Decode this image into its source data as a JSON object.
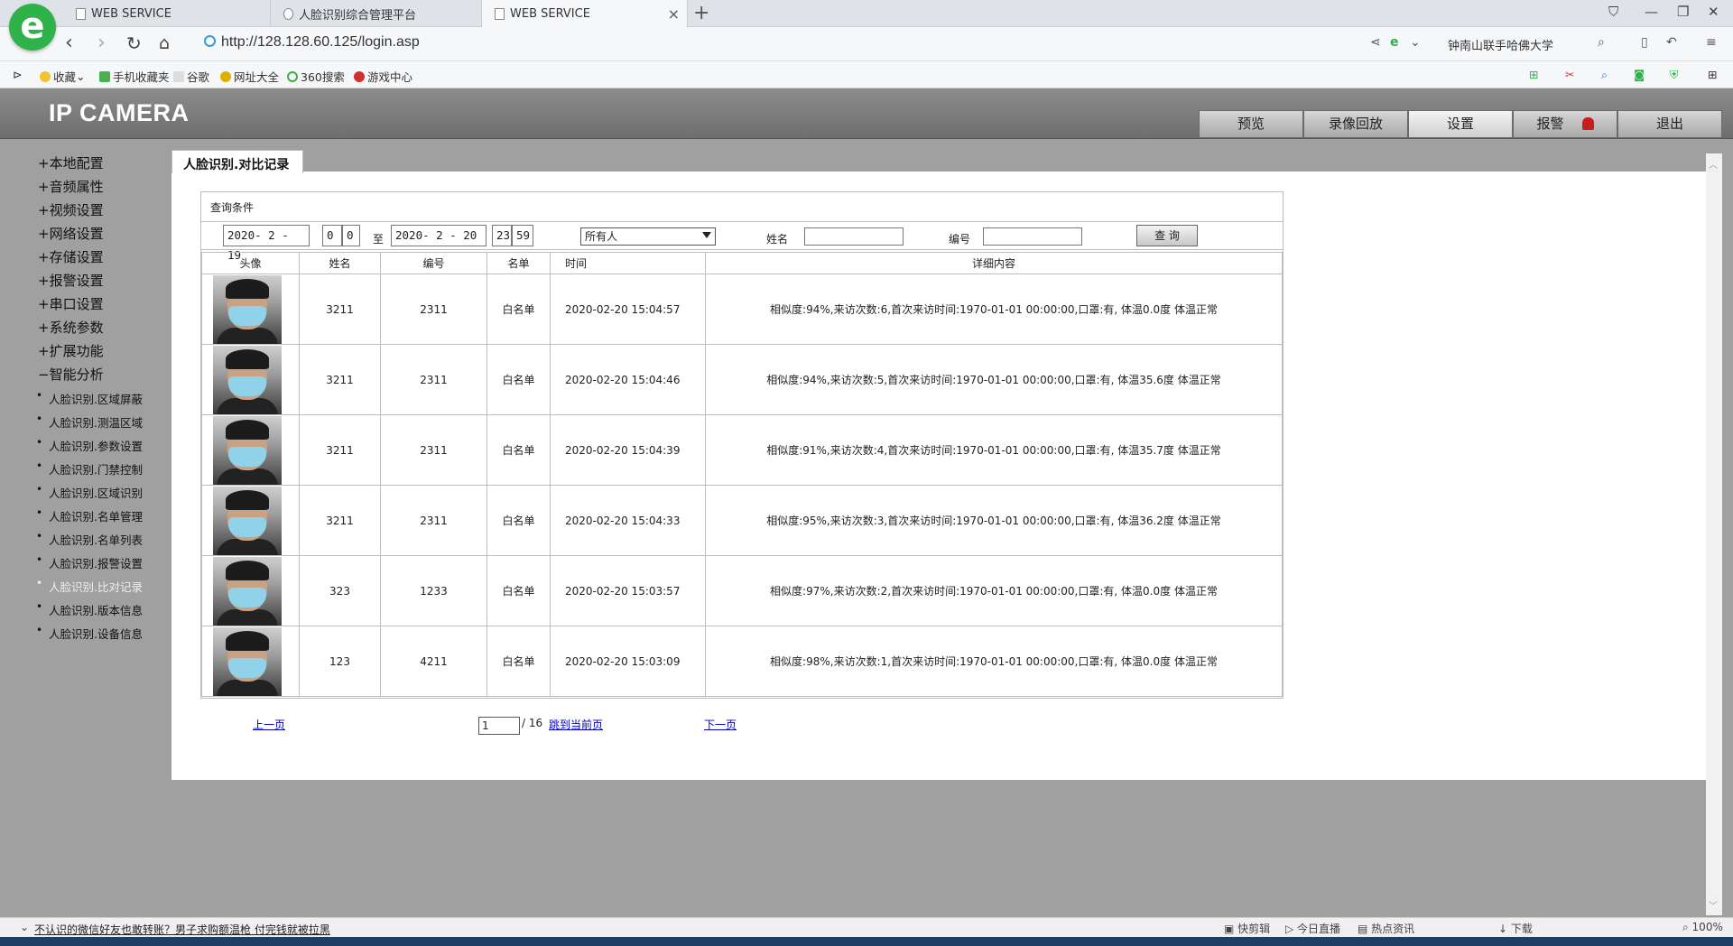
{
  "browser": {
    "tabs": [
      {
        "label": "WEB SERVICE"
      },
      {
        "label": "人脸识别综合管理平台"
      },
      {
        "label": "WEB SERVICE"
      }
    ],
    "url": "http://128.128.60.125/login.asp",
    "search_text": "钟南山联手哈佛大学",
    "favorites": [
      "收藏",
      "手机收藏夹",
      "谷歌",
      "网址大全",
      "360搜索",
      "游戏中心"
    ]
  },
  "camera": {
    "title": "IP CAMERA",
    "nav": [
      "预览",
      "录像回放",
      "设置",
      "报警",
      "退出"
    ],
    "sidebar": {
      "menu": [
        "+本地配置",
        "+音频属性",
        "+视频设置",
        "+网络设置",
        "+存储设置",
        "+报警设置",
        "+串口设置",
        "+系统参数",
        "+扩展功能",
        "−智能分析"
      ],
      "sub": [
        "人脸识别.区域屏蔽",
        "人脸识别.测温区域",
        "人脸识别.参数设置",
        "人脸识别.门禁控制",
        "人脸识别.区域识别",
        "人脸识别.名单管理",
        "人脸识别.名单列表",
        "人脸识别.报警设置",
        "人脸识别.比对记录",
        "人脸识别.版本信息",
        "人脸识别.设备信息"
      ]
    },
    "content_tab": "人脸识别.对比记录",
    "query": {
      "label": "查询条件",
      "from_date": "2020- 2 - 19",
      "from_hour": "0",
      "from_min": "0",
      "to_text": "至",
      "to_date": "2020- 2 - 20",
      "to_hour": "23",
      "to_min": "59",
      "who": "所有人",
      "name_label": "姓名",
      "id_label": "编号",
      "button": "查 询"
    },
    "table": {
      "headers": [
        "头像",
        "姓名",
        "编号",
        "名单",
        "时间",
        "详细内容"
      ],
      "rows": [
        {
          "name": "3211",
          "id": "2311",
          "list": "白名单",
          "time": "2020-02-20 15:04:57",
          "detail": "相似度:94%,来访次数:6,首次来访时间:1970-01-01 00:00:00,口罩:有, 体温0.0度 体温正常"
        },
        {
          "name": "3211",
          "id": "2311",
          "list": "白名单",
          "time": "2020-02-20 15:04:46",
          "detail": "相似度:94%,来访次数:5,首次来访时间:1970-01-01 00:00:00,口罩:有, 体温35.6度 体温正常"
        },
        {
          "name": "3211",
          "id": "2311",
          "list": "白名单",
          "time": "2020-02-20 15:04:39",
          "detail": "相似度:91%,来访次数:4,首次来访时间:1970-01-01 00:00:00,口罩:有, 体温35.7度 体温正常"
        },
        {
          "name": "3211",
          "id": "2311",
          "list": "白名单",
          "time": "2020-02-20 15:04:33",
          "detail": "相似度:95%,来访次数:3,首次来访时间:1970-01-01 00:00:00,口罩:有, 体温36.2度 体温正常"
        },
        {
          "name": "323",
          "id": "1233",
          "list": "白名单",
          "time": "2020-02-20 15:03:57",
          "detail": "相似度:97%,来访次数:2,首次来访时间:1970-01-01 00:00:00,口罩:有, 体温0.0度 体温正常"
        },
        {
          "name": "123",
          "id": "4211",
          "list": "白名单",
          "time": "2020-02-20 15:03:09",
          "detail": "相似度:98%,来访次数:1,首次来访时间:1970-01-01 00:00:00,口罩:有, 体温0.0度 体温正常"
        }
      ]
    },
    "pager": {
      "prev": "上一页",
      "page": "1",
      "total": "/ 16",
      "jump": "跳到当前页",
      "next": "下一页"
    }
  },
  "statusbar": {
    "news": "不认识的微信好友也敢转账？男子求购额温枪 付完钱就被拉黑",
    "items": [
      "快剪辑",
      "今日直播",
      "热点资讯",
      "下载",
      "100%"
    ]
  }
}
